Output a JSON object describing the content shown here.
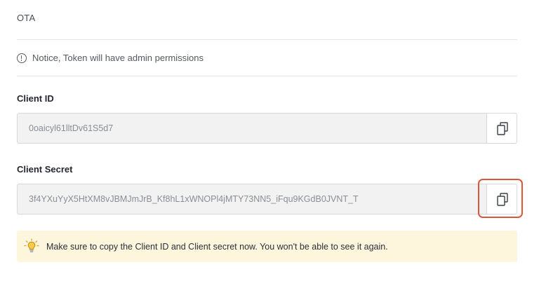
{
  "token": {
    "name": "OTA"
  },
  "notice": {
    "icon": "info-icon",
    "text": "Notice, Token will have admin permissions"
  },
  "client_id": {
    "label": "Client ID",
    "value": "0oaicyl61lltDv61S5d7",
    "copy_icon": "copy-icon"
  },
  "client_secret": {
    "label": "Client Secret",
    "value": "3f4YXuYyX5HtXM8vJBMJmJrB_Kf8hL1xWNOPl4jMTY73NN5_iFqu9KGdB0JVNT_T",
    "copy_icon": "copy-icon"
  },
  "warning": {
    "icon": "lightbulb-icon",
    "text": "Make sure to copy the Client ID and Client secret now. You won't be able to see it again."
  },
  "colors": {
    "highlight": "#d9563b",
    "warning_background": "#fdf6dc",
    "input_background": "#f2f2f3"
  }
}
